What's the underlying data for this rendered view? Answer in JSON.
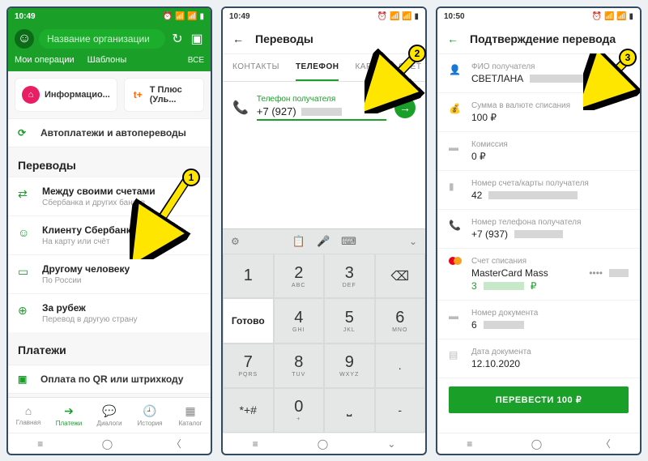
{
  "status_time": {
    "s1": "10:49",
    "s2": "10:49",
    "s3": "10:50"
  },
  "screen1": {
    "search_placeholder": "Название организации",
    "tabs": {
      "ops": "Мои операции",
      "templ": "Шаблоны",
      "all": "ВСЕ"
    },
    "cards": {
      "c1": "Информацио...",
      "c2": "Т Плюс (Уль...",
      "c2_icon": "t+"
    },
    "autopay": "Автоплатежи и автопереводы",
    "sec_transfers": "Переводы",
    "items": [
      {
        "title": "Между своими счетами",
        "sub": "Сбербанка и других банков"
      },
      {
        "title": "Клиенту Сбербанка",
        "sub": "На карту или счёт"
      },
      {
        "title": "Другому человеку",
        "sub": "По России"
      },
      {
        "title": "За рубеж",
        "sub": "Перевод в другую страну"
      }
    ],
    "sec_pay": "Платежи",
    "qr": "Оплата по QR или штрихкоду",
    "tabbar": [
      "Главная",
      "Платежи",
      "Диалоги",
      "История",
      "Каталог"
    ]
  },
  "screen2": {
    "title": "Переводы",
    "tabs": [
      "КОНТАКТЫ",
      "ТЕЛЕФОН",
      "КАРТА",
      "СЧЁТ"
    ],
    "field_label": "Телефон получателя",
    "field_value": "+7 (927)",
    "keypad": {
      "r0": [
        {
          "d": "1",
          "s": ""
        },
        {
          "d": "2",
          "s": "ABC"
        },
        {
          "d": "3",
          "s": "DEF"
        },
        {
          "d": "⌫",
          "s": ""
        }
      ],
      "r1": [
        {
          "d": "4",
          "s": "GHI"
        },
        {
          "d": "5",
          "s": "JKL"
        },
        {
          "d": "6",
          "s": "MNO"
        },
        {
          "d": "Готово",
          "s": ""
        }
      ],
      "r2": [
        {
          "d": "7",
          "s": "PQRS"
        },
        {
          "d": "8",
          "s": "TUV"
        },
        {
          "d": "9",
          "s": "WXYZ"
        },
        {
          "d": ".",
          "s": ""
        }
      ],
      "r3": [
        {
          "d": "✱",
          "s": ""
        },
        {
          "d": "0",
          "s": "+"
        },
        {
          "d": "#",
          "s": ""
        },
        {
          "d": "-",
          "s": ""
        }
      ]
    },
    "go_label": "Готово",
    "ext_sym": "*+#"
  },
  "screen3": {
    "title": "Подтверждение перевода",
    "rows": {
      "fio_l": "ФИО получателя",
      "fio_v": "СВЕТЛАНА",
      "sum_l": "Сумма в валюте списания",
      "sum_v": "100 ₽",
      "fee_l": "Комиссия",
      "fee_v": "0 ₽",
      "acc_l": "Номер счета/карты получателя",
      "acc_v": "42",
      "tel_l": "Номер телефона получателя",
      "tel_v": "+7 (937)",
      "src_l": "Счет списания",
      "src_v": "MasterCard Mass",
      "src_bal": "3",
      "src_cur": "₽",
      "src_dots": "••••",
      "doc_l": "Номер документа",
      "doc_v": "6",
      "date_l": "Дата документа",
      "date_v": "12.10.2020"
    },
    "btn": "ПЕРЕВЕСТИ 100 ₽"
  },
  "callouts": {
    "n1": "1",
    "n2": "2",
    "n3": "3"
  }
}
